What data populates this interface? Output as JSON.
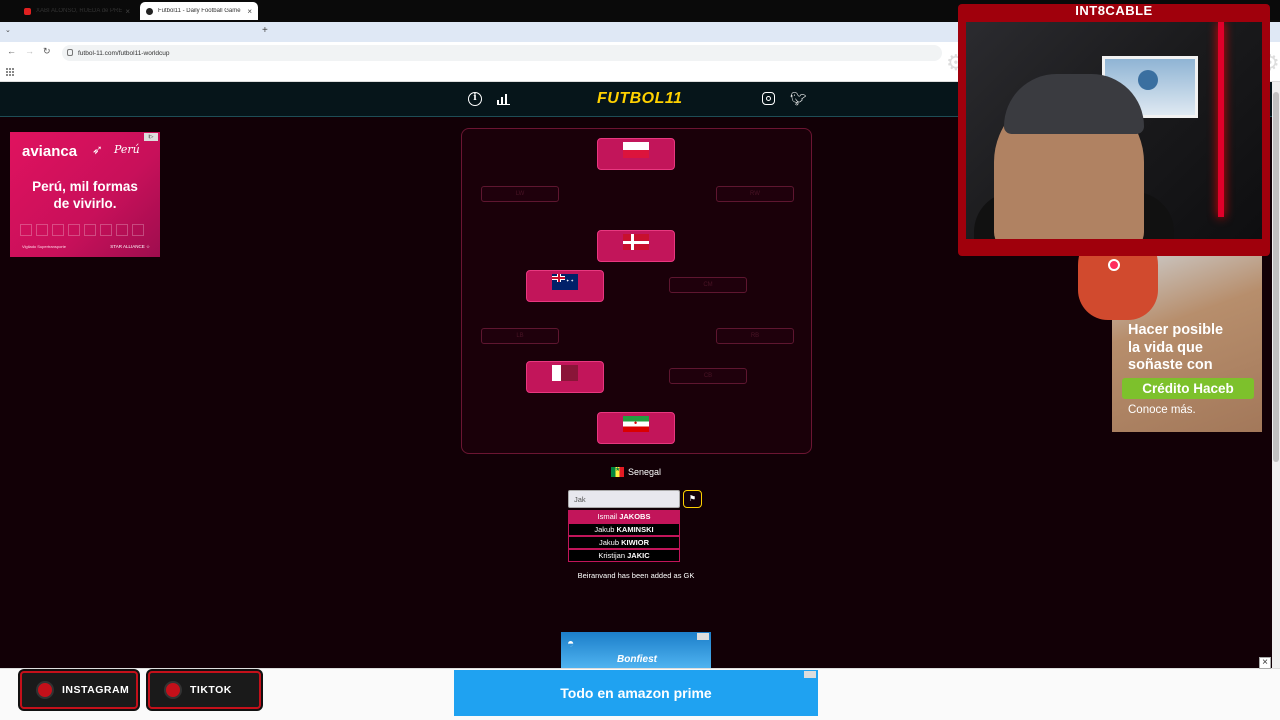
{
  "browser": {
    "tabs": [
      {
        "title": "XABI ALONSO, RUEDA de PRENSA",
        "active": false,
        "favicon_color": "#e02020"
      },
      {
        "title": "Futbol11 - Daily Football Game",
        "active": true,
        "favicon_color": "#222222"
      }
    ],
    "url": "futbol-11.com/futbol11-worldcup"
  },
  "site": {
    "logo": "FUTBOL11",
    "accent": "#ffd100",
    "icons": [
      "info-icon",
      "stats-icon",
      "instagram-icon",
      "twitter-icon"
    ]
  },
  "ad_left": {
    "brand": "avianca",
    "partner": "Perú",
    "slogan_line1": "Perú, mil formas",
    "slogan_line2": "de vivirlo.",
    "footer_left": "Vigilado Supertransporte",
    "footer_right": "STAR ALLIANCE ☆"
  },
  "pitch": {
    "formation_slots": [
      {
        "position": "LW",
        "filled": false
      },
      {
        "position": "RW",
        "filled": false
      },
      {
        "position": "CM",
        "filled": false
      },
      {
        "position": "LB",
        "filled": false
      },
      {
        "position": "RB",
        "filled": false
      },
      {
        "position": "CB",
        "filled": false
      }
    ],
    "players": [
      {
        "country": "Poland",
        "flag": "flag-poland"
      },
      {
        "country": "Denmark",
        "flag": "flag-denmark"
      },
      {
        "country": "Australia",
        "flag": "flag-australia"
      },
      {
        "country": "Qatar",
        "flag": "flag-qatar"
      },
      {
        "country": "Iran",
        "flag": "flag-iran"
      }
    ]
  },
  "guess": {
    "country": "Senegal",
    "input_value": "Jak",
    "suggestions": [
      {
        "first": "Ismail",
        "last": "JAKOBS",
        "highlighted": true
      },
      {
        "first": "Jakub",
        "last": "KAMINSKI",
        "highlighted": false
      },
      {
        "first": "Jakub",
        "last": "KIWIOR",
        "highlighted": false
      },
      {
        "first": "Kristijan",
        "last": "JAKIC",
        "highlighted": false
      }
    ],
    "status": "Beiranvand has been added as GK"
  },
  "ad_bonfiest": {
    "title": "Bonfiest"
  },
  "ad_amazon": {
    "text": "Todo en amazon prime"
  },
  "stream_overlay": {
    "channel": "INT8CABLE",
    "social": [
      "INSTAGRAM",
      "TIKTOK"
    ]
  },
  "ad_right": {
    "line1": "Hacer posible",
    "line2": "la vida que",
    "line3": "soñaste con",
    "cta": "Crédito Haceb",
    "more": "Conoce más."
  }
}
